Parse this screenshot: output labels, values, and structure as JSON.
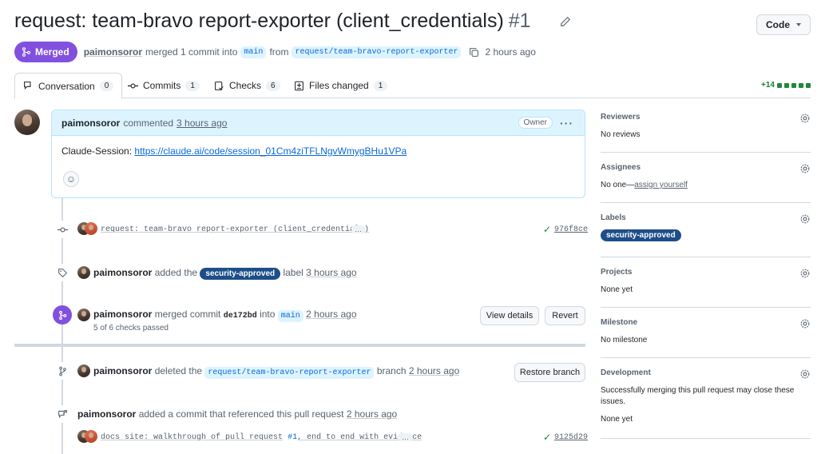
{
  "header": {
    "title": "request: team-bravo report-exporter (client_credentials)",
    "number": "#1",
    "code_button": "Code"
  },
  "meta": {
    "status": "Merged",
    "author": "paimonsoror",
    "merged_text": "merged 1 commit into",
    "base_branch": "main",
    "from_text": "from",
    "head_branch": "request/team-bravo-report-exporter",
    "time": "2 hours ago"
  },
  "tabs": [
    {
      "label": "Conversation",
      "count": "0"
    },
    {
      "label": "Commits",
      "count": "1"
    },
    {
      "label": "Checks",
      "count": "6"
    },
    {
      "label": "Files changed",
      "count": "1"
    }
  ],
  "diffstat": {
    "additions": "+14"
  },
  "comment": {
    "author": "paimonsoror",
    "action": "commented",
    "time": "3 hours ago",
    "badge": "Owner",
    "body_prefix": "Claude-Session:",
    "body_link": "https://claude.ai/code/session_01Cm4ziTFLNgvWmygBHu1VPa"
  },
  "timeline": {
    "commit1": {
      "message": "request: team-bravo report-exporter (client_credentials)",
      "sha": "976f8ce"
    },
    "label_event": {
      "who": "paimonsoror",
      "pre": "added the",
      "label": "security-approved",
      "post": "label",
      "time": "3 hours ago"
    },
    "merge_event": {
      "who": "paimonsoror",
      "pre": "merged commit",
      "sha": "de172bd",
      "mid": "into",
      "branch": "main",
      "time": "2 hours ago",
      "checks": "5 of 6 checks passed",
      "view_details": "View details",
      "revert": "Revert"
    },
    "delete_event": {
      "who": "paimonsoror",
      "pre": "deleted the",
      "branch": "request/team-bravo-report-exporter",
      "post": "branch",
      "time": "2 hours ago",
      "restore": "Restore branch"
    },
    "ref_event": {
      "who": "paimonsoror",
      "text": "added a commit that referenced this pull request",
      "time": "2 hours ago"
    },
    "commit2": {
      "message_pre": "docs site: walkthrough of pull request",
      "ref": "#1",
      "message_post": ", end to end with evidence",
      "sha": "9125d29"
    }
  },
  "sidebar": {
    "reviewers": {
      "title": "Reviewers",
      "value": "No reviews"
    },
    "assignees": {
      "title": "Assignees",
      "value": "No one—",
      "link": "assign yourself"
    },
    "labels": {
      "title": "Labels",
      "label": "security-approved"
    },
    "projects": {
      "title": "Projects",
      "value": "None yet"
    },
    "milestone": {
      "title": "Milestone",
      "value": "No milestone"
    },
    "development": {
      "title": "Development",
      "text": "Successfully merging this pull request may close these issues.",
      "value": "None yet"
    }
  },
  "colors": {
    "merged": "#8250df",
    "link": "#0969da",
    "label_bg": "#1d4e89",
    "success": "#1a7f37"
  }
}
